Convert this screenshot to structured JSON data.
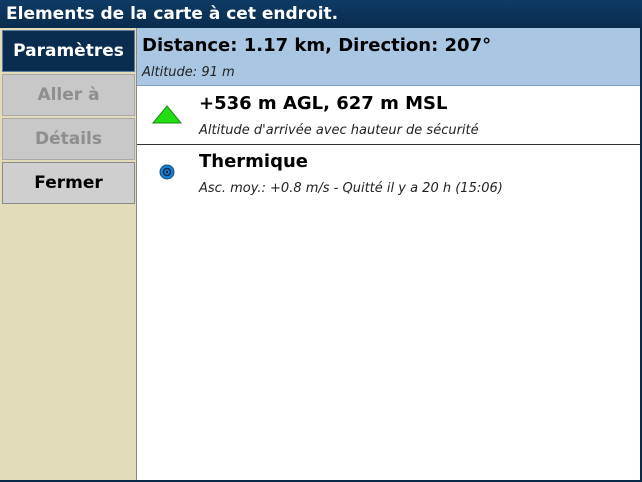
{
  "window": {
    "title": "Elements de la carte à cet endroit."
  },
  "sidebar": {
    "buttons": [
      {
        "label": "Paramètres",
        "state": "active"
      },
      {
        "label": "Aller à",
        "state": "disabled"
      },
      {
        "label": "Détails",
        "state": "disabled"
      },
      {
        "label": "Fermer",
        "state": "enabled"
      }
    ]
  },
  "location": {
    "title": "Distance: 1.17 km, Direction: 207°",
    "subtitle": "Altitude: 91 m"
  },
  "items": [
    {
      "icon": "arrival-altitude-triangle-icon",
      "title": "+536 m AGL, 627 m MSL",
      "subtitle": "Altitude d'arrivée avec hauteur de sécurité"
    },
    {
      "icon": "thermal-icon",
      "title": "Thermique",
      "subtitle": "Asc. moy.: +0.8 m/s - Quitté il y a 20 h (15:06)"
    }
  ],
  "colors": {
    "titlebar": "#0a2c4e",
    "sidebar": "#e2dcbb",
    "header_highlight": "#a9c7e3",
    "triangle_fill": "#22dd11",
    "thermal_blue": "#1a7fd0"
  }
}
